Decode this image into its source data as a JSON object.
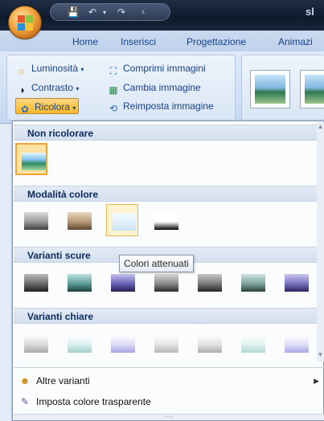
{
  "titlebar": {
    "title_partial": "sl"
  },
  "tabs": [
    "Home",
    "Inserisci",
    "Progettazione",
    "Animazi"
  ],
  "ribbon": {
    "commands": {
      "luminosita": "Luminosità",
      "contrasto": "Contrasto",
      "ricolora": "Ricolora",
      "comprimi": "Comprimi immagini",
      "cambia": "Cambia immagine",
      "reimposta": "Reimposta immagine"
    }
  },
  "menu": {
    "sections": {
      "non_ricolorare": "Non ricolorare",
      "modalita_colore": "Modalità colore",
      "varianti_scure": "Varianti scure",
      "varianti_chiare": "Varianti chiare"
    },
    "tooltip": "Colori attenuati",
    "items": {
      "altre_varianti": "Altre varianti",
      "imposta_trasparente": "Imposta colore trasparente"
    },
    "modalita_swatches": [
      {
        "name": "grayscale",
        "top": "#dadada",
        "mid": "#9a9a9a",
        "bot": "#3f3f3f"
      },
      {
        "name": "sepia",
        "top": "#e8d8c0",
        "mid": "#b89a76",
        "bot": "#5d4632"
      },
      {
        "name": "washout",
        "top": "#f4fbff",
        "mid": "#dff0fa",
        "bot": "#c8e3ee"
      },
      {
        "name": "black-white",
        "top": "#ffffff",
        "mid": "#ffffff",
        "bot": "#000000"
      }
    ],
    "scure_swatches": [
      {
        "top": "#bcbcbc",
        "mid": "#6a6a6a",
        "bot": "#202020"
      },
      {
        "top": "#bfe3e0",
        "mid": "#5a9c98",
        "bot": "#1c3f3d"
      },
      {
        "top": "#c7c3ef",
        "mid": "#6a62b8",
        "bot": "#241f52"
      },
      {
        "top": "#d6d6d6",
        "mid": "#8b8b8b",
        "bot": "#2a2a2a"
      },
      {
        "top": "#c8c8c8",
        "mid": "#7a7a7a",
        "bot": "#252525"
      },
      {
        "top": "#cfe3df",
        "mid": "#7da49e",
        "bot": "#2a3f3b"
      },
      {
        "top": "#cbc7ee",
        "mid": "#7a72c0",
        "bot": "#2a2560"
      }
    ],
    "chiare_swatches": [
      {
        "top": "#ffffff",
        "mid": "#d8d8d8",
        "bot": "#a8a8a8"
      },
      {
        "top": "#ffffff",
        "mid": "#d7efed",
        "bot": "#a8cfcb"
      },
      {
        "top": "#ffffff",
        "mid": "#dcdaf6",
        "bot": "#a9a3e0"
      },
      {
        "top": "#ffffff",
        "mid": "#e3e3e3",
        "bot": "#b8b8b8"
      },
      {
        "top": "#ffffff",
        "mid": "#e0e0e0",
        "bot": "#aeaeae"
      },
      {
        "top": "#ffffff",
        "mid": "#dff1ee",
        "bot": "#b0d8d3"
      },
      {
        "top": "#ffffff",
        "mid": "#dedcf7",
        "bot": "#aba6e3"
      }
    ]
  },
  "colors": {
    "accent_orange": "#f0a43a",
    "ribbon_text": "#15428b",
    "header_text": "#0b2a5b"
  },
  "icons": [
    "office-button-icon",
    "save-icon",
    "undo-icon",
    "redo-icon",
    "qat-dropdown-icon",
    "brightness-icon",
    "contrast-icon",
    "recolor-icon",
    "compress-icon",
    "change-picture-icon",
    "reset-picture-icon",
    "more-variations-icon",
    "set-transparent-icon"
  ]
}
